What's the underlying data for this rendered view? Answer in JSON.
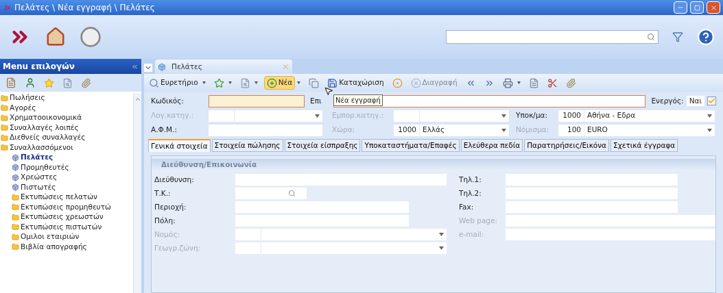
{
  "window": {
    "title": "Πελάτες \\ Νέα εγγραφή \\ Πελάτες"
  },
  "sidebar": {
    "title": "Menu επιλογών",
    "items": [
      {
        "label": "Πωλήσεις",
        "selected": false
      },
      {
        "label": "Αγορές",
        "selected": false
      },
      {
        "label": "Χρηματοοικονομικά",
        "selected": false
      },
      {
        "label": "Συναλλαγές λοιπές",
        "selected": false
      },
      {
        "label": "Διεθνείς συναλλαγές",
        "selected": false
      },
      {
        "label": "Συναλλασσόμενοι",
        "selected": false,
        "children": [
          {
            "label": "Πελάτες",
            "kind": "entity",
            "selected": true
          },
          {
            "label": "Προμηθευτές",
            "kind": "entity",
            "selected": false
          },
          {
            "label": "Χρεώστες",
            "kind": "entity",
            "selected": false
          },
          {
            "label": "Πιστωτές",
            "kind": "entity",
            "selected": false
          },
          {
            "label": "Εκτυπώσεις πελατών",
            "kind": "folder",
            "selected": false
          },
          {
            "label": "Εκτυπώσεις προμηθευτώ",
            "kind": "folder",
            "selected": false
          },
          {
            "label": "Εκτυπώσεις χρεωστών",
            "kind": "folder",
            "selected": false
          },
          {
            "label": "Εκτυπώσεις πιστωτών",
            "kind": "folder",
            "selected": false
          },
          {
            "label": "Ομιλοι εταιριών",
            "kind": "folder",
            "selected": false
          },
          {
            "label": "Βιβλία απογραφής",
            "kind": "folder",
            "selected": false
          }
        ]
      }
    ]
  },
  "document_tab": {
    "label": "Πελάτες"
  },
  "toolbar": [
    {
      "label": "Ευρετήριο",
      "dropdown": true,
      "disabled": false,
      "highlighted": false
    },
    {
      "dropdown": true,
      "disabled": false,
      "highlighted": false
    },
    {
      "dropdown": true,
      "disabled": false,
      "highlighted": false
    },
    {
      "label": "Νέα",
      "dropdown": true,
      "disabled": false,
      "highlighted": true
    },
    {
      "dropdown": false,
      "disabled": false,
      "highlighted": false
    },
    {
      "label": "Καταχώριση",
      "dropdown": false,
      "disabled": false,
      "highlighted": false
    },
    {
      "dropdown": false,
      "disabled": false,
      "highlighted": false
    },
    {
      "label": "Διαγραφή",
      "dropdown": false,
      "disabled": true,
      "highlighted": false
    },
    {
      "dropdown": false,
      "disabled": false,
      "highlighted": false
    },
    {
      "dropdown": false,
      "disabled": false,
      "highlighted": false
    },
    {
      "dropdown": true,
      "disabled": false,
      "highlighted": false
    },
    {
      "dropdown": false,
      "disabled": false,
      "highlighted": false
    },
    {
      "dropdown": false,
      "disabled": false,
      "highlighted": false
    },
    {
      "dropdown": false,
      "disabled": false,
      "highlighted": false
    }
  ],
  "tooltip": "Νέα εγγραφή",
  "header": {
    "code_label": "Κωδικός:",
    "name_label": "Επι",
    "active_label": "Ενεργός:",
    "active_value": "Ναι",
    "active": true,
    "rows": [
      [
        {
          "label": "Λογ.κατηγ.:",
          "disabled": true,
          "kind": "combo"
        },
        {
          "label": "Εμπορ.κατηγ.:",
          "disabled": true,
          "kind": "combo"
        },
        {
          "label": "Υποκ/μα:",
          "disabled": false,
          "kind": "combo",
          "code": "1000",
          "value": "Αθήνα - Εδρα"
        }
      ],
      [
        {
          "label": "Α.Φ.Μ.:",
          "disabled": false,
          "kind": "text"
        },
        {
          "label": "Χώρα:",
          "disabled": true,
          "kind": "combo",
          "code": "1000",
          "value": "Ελλάς"
        },
        {
          "label": "Νόμισμα:",
          "disabled": true,
          "kind": "combo",
          "code": "100",
          "value": "EURO"
        }
      ]
    ]
  },
  "tabs": [
    {
      "label": "Γενικά στοιχεία",
      "selected": true
    },
    {
      "label": "Στοιχεία πώλησης",
      "selected": false
    },
    {
      "label": "Στοιχεία είσπραξης",
      "selected": false
    },
    {
      "label": "Υποκαταστήματα/Επαφές",
      "selected": false
    },
    {
      "label": "Ελεύθερα πεδία",
      "selected": false
    },
    {
      "label": "Παρατηρήσεις/Εικόνα",
      "selected": false
    },
    {
      "label": "Σχετικά έγγραφα",
      "selected": false
    }
  ],
  "group": {
    "title": "Διεύθυνση/Επικοινωνία",
    "left": [
      {
        "label": "Διεύθυνση:",
        "disabled": false,
        "kind": "text"
      },
      {
        "label": "Τ.Κ.:",
        "disabled": false,
        "kind": "lookup"
      },
      {
        "label": "Περιοχή:",
        "disabled": false,
        "kind": "short"
      },
      {
        "label": "Πόλη:",
        "disabled": false,
        "kind": "short"
      },
      {
        "label": "Νομός:",
        "disabled": true,
        "kind": "combo"
      },
      {
        "label": "Γεωγρ.ζώνη:",
        "disabled": true,
        "kind": "combo"
      }
    ],
    "right": [
      {
        "label": "Τηλ.1:",
        "disabled": false,
        "kind": "short"
      },
      {
        "label": "Τηλ.2:",
        "disabled": false,
        "kind": "short"
      },
      {
        "label": "Fax:",
        "disabled": false,
        "kind": "short"
      },
      {
        "label": "Web page:",
        "disabled": true,
        "kind": "text"
      },
      {
        "label": "e-mail:",
        "disabled": true,
        "kind": "text"
      }
    ]
  }
}
